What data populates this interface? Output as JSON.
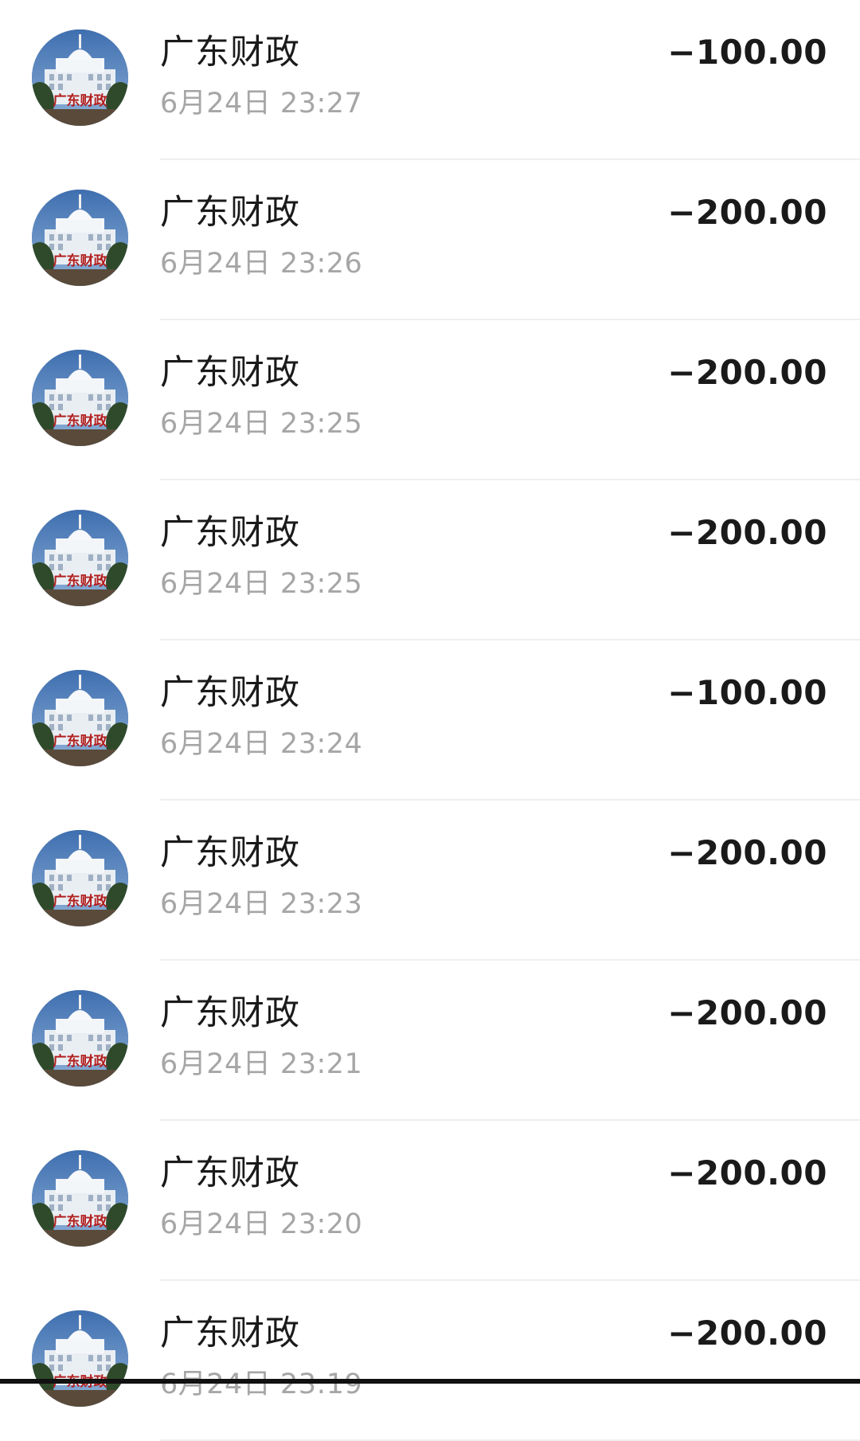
{
  "transactions": [
    {
      "name": "广东财政",
      "time": "6月24日 23:27",
      "amount": "−100.00",
      "avatar_text": "广东财政"
    },
    {
      "name": "广东财政",
      "time": "6月24日 23:26",
      "amount": "−200.00",
      "avatar_text": "广东财政"
    },
    {
      "name": "广东财政",
      "time": "6月24日 23:25",
      "amount": "−200.00",
      "avatar_text": "广东财政"
    },
    {
      "name": "广东财政",
      "time": "6月24日 23:25",
      "amount": "−200.00",
      "avatar_text": "广东财政"
    },
    {
      "name": "广东财政",
      "time": "6月24日 23:24",
      "amount": "−100.00",
      "avatar_text": "广东财政"
    },
    {
      "name": "广东财政",
      "time": "6月24日 23:23",
      "amount": "−200.00",
      "avatar_text": "广东财政"
    },
    {
      "name": "广东财政",
      "time": "6月24日 23:21",
      "amount": "−200.00",
      "avatar_text": "广东财政"
    },
    {
      "name": "广东财政",
      "time": "6月24日 23:20",
      "amount": "−200.00",
      "avatar_text": "广东财政"
    },
    {
      "name": "广东财政",
      "time": "6月24日 23:19",
      "amount": "−200.00",
      "avatar_text": "广东财政"
    }
  ],
  "colors": {
    "name": "#1a1a1a",
    "time": "#a6a6a6",
    "amount": "#1a1a1a",
    "divider": "#efefef",
    "avatar_label": "#b21e1e"
  },
  "icons": {
    "avatar": "government-building-icon"
  }
}
